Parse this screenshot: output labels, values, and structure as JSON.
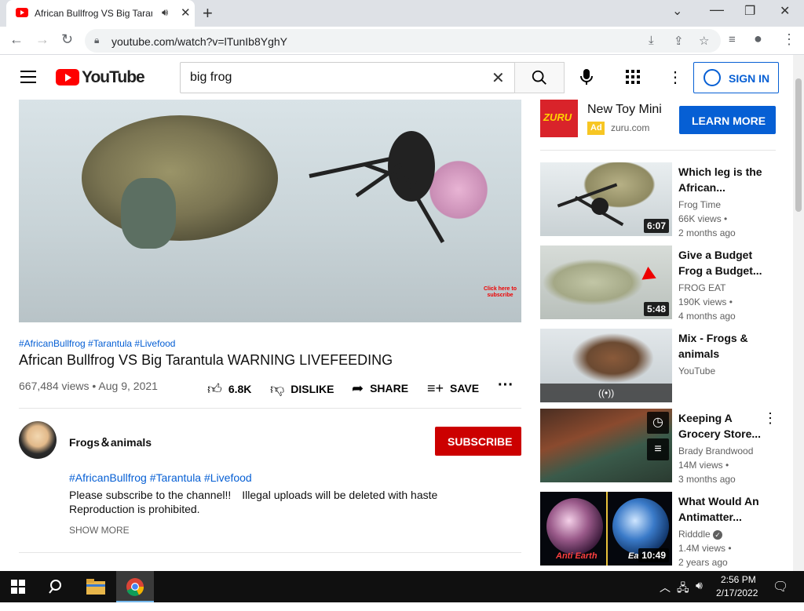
{
  "browser": {
    "tab_title": "African Bullfrog VS Big Taran",
    "url": "youtube.com/watch?v=lTunIb8YghY"
  },
  "header": {
    "logo_text": "YouTube",
    "search_value": "big frog",
    "sign_in_label": "SIGN IN"
  },
  "video": {
    "overlay_text": "Click here to subscribe",
    "hashtags": "#AfricanBullfrog #Tarantula #Livefood",
    "title": "African Bullfrog VS Big Tarantula WARNING LIVEFEEDING",
    "meta": "667,484 views • Aug 9, 2021",
    "likes": "6.8K",
    "dislike_label": "DISLIKE",
    "share_label": "SHARE",
    "save_label": "SAVE"
  },
  "channel": {
    "name": "Frogs＆animals",
    "subscribe_label": "SUBSCRIBE"
  },
  "description": {
    "tags": "#AfricanBullfrog #Tarantula #Livefood",
    "line1": "Please subscribe to the channel!!　Illegal uploads will be deleted with haste",
    "line2": "Reproduction is prohibited.",
    "show_more": "SHOW MORE"
  },
  "ad": {
    "logo_text": "ZURU",
    "title": "New Toy Mini",
    "badge": "Ad",
    "domain": "zuru.com",
    "cta": "LEARN MORE"
  },
  "suggestions": [
    {
      "title": "Which leg is the African...",
      "channel": "Frog Time",
      "views": "66K views •",
      "age": "2 months ago",
      "duration": "6:07"
    },
    {
      "title": "Give a Budget Frog a Budget...",
      "channel": "FROG EAT",
      "views": "190K views •",
      "age": "4 months ago",
      "duration": "5:48"
    },
    {
      "title": "Mix - Frogs & animals",
      "channel": "YouTube",
      "views": "",
      "age": "",
      "duration": ""
    },
    {
      "title": "Keeping A Grocery Store...",
      "channel": "Brady Brandwood",
      "views": "14M views •",
      "age": "3 months ago",
      "duration": ""
    },
    {
      "title": "What Would An Antimatter...",
      "channel": "Ridddle",
      "views": "1.4M views •",
      "age": "2 years ago",
      "duration": "10:49",
      "thumb_text_left": "Anti Earth",
      "thumb_text_right": "Ea"
    }
  ],
  "taskbar": {
    "time": "2:56 PM",
    "date": "2/17/2022"
  },
  "colors": {
    "yt_red": "#ff0000",
    "subscribe_red": "#cc0000",
    "link_blue": "#065fd4"
  }
}
